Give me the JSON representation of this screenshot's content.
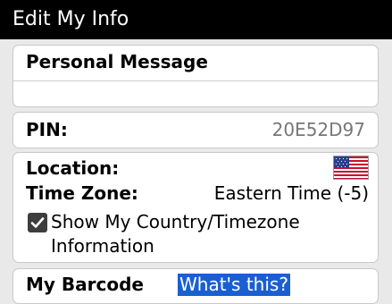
{
  "header": {
    "title": "Edit My Info"
  },
  "personal_message": {
    "label": "Personal Message",
    "value": ""
  },
  "pin": {
    "label": "PIN:",
    "value": "20E52D97"
  },
  "location": {
    "label": "Location:",
    "flag_icon": "us-flag-icon",
    "timezone_label": "Time Zone:",
    "timezone_value": "Eastern Time (-5)",
    "show_checkbox_label": "Show My Country/Timezone Information",
    "show_checkbox_checked": true
  },
  "barcode": {
    "label": "My Barcode",
    "link": "What's this?"
  },
  "colors": {
    "titlebar_bg": "#000000",
    "panel_bg": "#ffffff",
    "page_bg": "#e9e9e9",
    "link_highlight": "#1a5fd0"
  }
}
